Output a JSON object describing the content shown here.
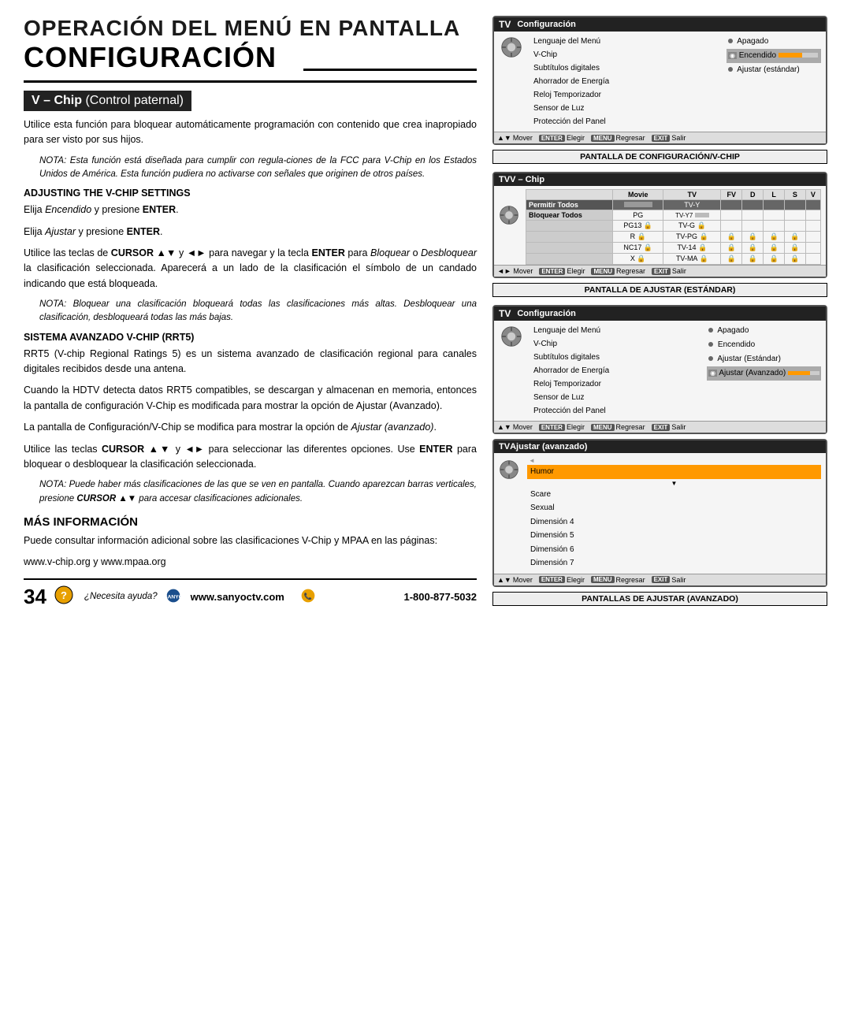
{
  "page": {
    "main_title": "OPERACIÓN DEL MENÚ EN PANTALLA",
    "sub_title": "CONFIGURACIÓN",
    "page_number": "34",
    "footer_help": "¿Necesita ayuda?",
    "footer_website": "www.sanyoctv.com",
    "footer_phone": "1-800-877-5032"
  },
  "vchip_section": {
    "heading": "V – Chip",
    "heading_sub": "(Control paternal)",
    "intro_text": "Utilice esta función para bloquear automáticamente programación con contenido que crea inapropiado para ser visto por sus hijos.",
    "note1": "NOTA: Esta función está diseñada para cumplir con regula-ciones de la FCC para V-Chip en los Estados Unidos de América. Esta función pudiera no activarse con señales que originen de otros países.",
    "adjusting_title": "ADJUSTING THE V-CHIP SETTINGS",
    "adjust_step1": "Elija Encendido y presione ENTER.",
    "adjust_step2": "Elija Ajustar y presione ENTER.",
    "adjust_body": "Utilice las teclas de CURSOR ▲▼ y ◄► para navegar y la tecla ENTER para Bloquear o Desbloquear la clasificación seleccionada. Aparecerá a un lado de la clasificación el símbolo de un candado indicando que está bloqueada.",
    "note2": "NOTA: Bloquear una clasificación bloqueará todas las clasificaciones más altas. Desbloquear una clasificación, desbloqueará todas las más bajas.",
    "sistema_title": "SISTEMA AVANZADO V-CHIP (RRT5)",
    "sistema_body1": "RRT5 (V-chip Regional Ratings 5) es un sistema avanzado de clasificación regional para canales digitales recibidos desde una antena.",
    "sistema_body2": "Cuando la HDTV detecta datos RRT5 compatibles, se descargan y almacenan en memoria, entonces la pantalla de configuración V-Chip es modificada para mostrar la opción de Ajustar (Avanzado).",
    "sistema_body3": "La pantalla de Configuración/V-Chip se modifica para mostrar la opción de Ajustar (avanzado).",
    "sistema_body4": "Utilice las teclas CURSOR ▲▼ y ◄► para seleccionar las diferentes opciones. Use ENTER para bloquear o desbloquear la clasificación seleccionada.",
    "note3": "NOTA: Puede haber más clasificaciones de las que se ven en pantalla. Cuando aparezcan barras verticales, presione CURSOR ▲▼ para accesar clasificaciones adicionales."
  },
  "mas_info": {
    "title": "MÁS INFORMACIÓN",
    "body": "Puede consultar información adicional sobre las clasificaciones V-Chip y MPAA en las páginas:",
    "url": "www.v-chip.org y www.mpaa.org"
  },
  "screens": {
    "config_screen": {
      "label": "TV",
      "header_text": "Configuración",
      "menu_items": [
        "Lenguaje del Menú",
        "V-Chip",
        "Subtítulos digitales",
        "Ahorrador de Energía",
        "Reloj Temporizador",
        "Sensor de Luz",
        "Protección del Panel"
      ],
      "options": [
        "Apagado",
        "Encendido",
        "Ajustar (estándar)"
      ],
      "selected_option": "Encendido",
      "caption": "PANTALLA DE CONFIGURACIÓN/V-CHIP",
      "footer": [
        "Mover",
        "ENTER Elegir",
        "MENU Regresar",
        "EXIT Salir"
      ]
    },
    "vchip_grid": {
      "label": "TV",
      "header_text": "V – Chip",
      "col_headers": [
        "Movie",
        "TV",
        "FV",
        "D",
        "L",
        "S",
        "V"
      ],
      "rows": [
        {
          "label": "Permitir Todos",
          "movie": "bar",
          "tv": "TV-Y",
          "cols": [
            "",
            "",
            "",
            "",
            ""
          ]
        },
        {
          "label": "Bloquear Todos",
          "movie": "PG",
          "tv": "TV-Y7",
          "cols": [
            "",
            "",
            "",
            "",
            ""
          ]
        },
        {
          "label": "",
          "movie": "PG13",
          "lock": true,
          "tv": "TV-G",
          "lock2": true,
          "cols": [
            "",
            "",
            "",
            "",
            ""
          ]
        },
        {
          "label": "",
          "movie": "R",
          "lock": true,
          "tv": "TV-PG",
          "lock2": true,
          "cols": [
            "🔒",
            "🔒",
            "🔒",
            "🔒",
            ""
          ]
        },
        {
          "label": "",
          "movie": "NC17",
          "lock": true,
          "tv": "TV-14",
          "lock2": true,
          "cols": [
            "🔒",
            "🔒",
            "🔒",
            "🔒",
            ""
          ]
        },
        {
          "label": "",
          "movie": "X",
          "lock": true,
          "tv": "TV-MA",
          "lock2": true,
          "cols": [
            "🔒",
            "🔒",
            "🔒",
            "🔒",
            ""
          ]
        }
      ],
      "caption": "PANTALLA DE AJUSTAR (ESTÁNDAR)",
      "footer": [
        "◄► Mover",
        "ENTER Elegir",
        "MENU Regresar",
        "EXIT Salir"
      ]
    },
    "config_screen2": {
      "label": "TV",
      "header_text": "Configuración",
      "menu_items": [
        "Lenguaje del Menú",
        "V-Chip",
        "Subtítulos digitales",
        "Ahorrador de Energía",
        "Reloj Temporizador",
        "Sensor de Luz",
        "Protección del Panel"
      ],
      "options": [
        "Apagado",
        "Encendido",
        "Ajustar (Estándar)",
        "Ajustar (Avanzado)"
      ],
      "selected_option": "Ajustar (Avanzado)",
      "footer": [
        "Mover",
        "ENTER Elegir",
        "MENU Regresar",
        "EXIT Salir"
      ]
    },
    "advanced_screen": {
      "label": "TV",
      "header_text": "Ajustar (avanzado)",
      "menu_items": [
        "Humor",
        "Scare",
        "Sexual",
        "Dimensión 4",
        "Dimensión 5",
        "Dimensión 6",
        "Dimensión 7"
      ],
      "selected_item": "Humor",
      "caption": "PANTALLAS DE AJUSTAR (AVANZADO)",
      "footer": [
        "Mover",
        "ENTER Elegir",
        "MENU Regresar",
        "EXIT Salir"
      ]
    }
  }
}
